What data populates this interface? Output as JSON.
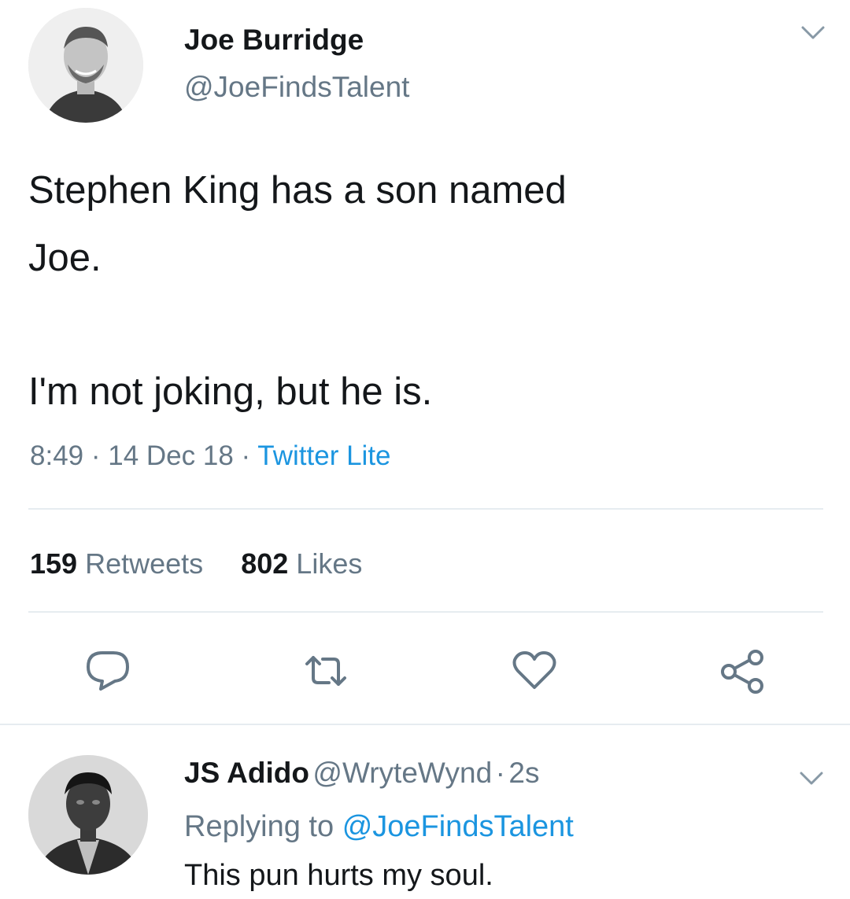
{
  "tweet": {
    "author_name": "Joe Burridge",
    "author_handle": "@JoeFindsTalent",
    "text_line1": "Stephen King has a son named",
    "text_line2": "Joe.",
    "text_line3": "I'm not joking, but he is.",
    "time": "8:49",
    "date": "14 Dec 18",
    "source": "Twitter Lite",
    "sep": "·",
    "retweets_count": "159",
    "retweets_label": "Retweets",
    "likes_count": "802",
    "likes_label": "Likes"
  },
  "reply": {
    "author_name": "JS Adido",
    "author_handle": "@WryteWynd",
    "age": "2s",
    "sep": "·",
    "replying_prefix": "Replying to",
    "replying_to": "@JoeFindsTalent",
    "text": "This pun hurts my soul."
  },
  "icons": {
    "reply": "reply-icon",
    "retweet": "retweet-icon",
    "like": "heart-icon",
    "share": "share-icon",
    "menu": "chevron-down-icon"
  },
  "colors": {
    "link": "#1b95e0",
    "secondary_text": "#657786",
    "divider": "#e6ecf0"
  }
}
